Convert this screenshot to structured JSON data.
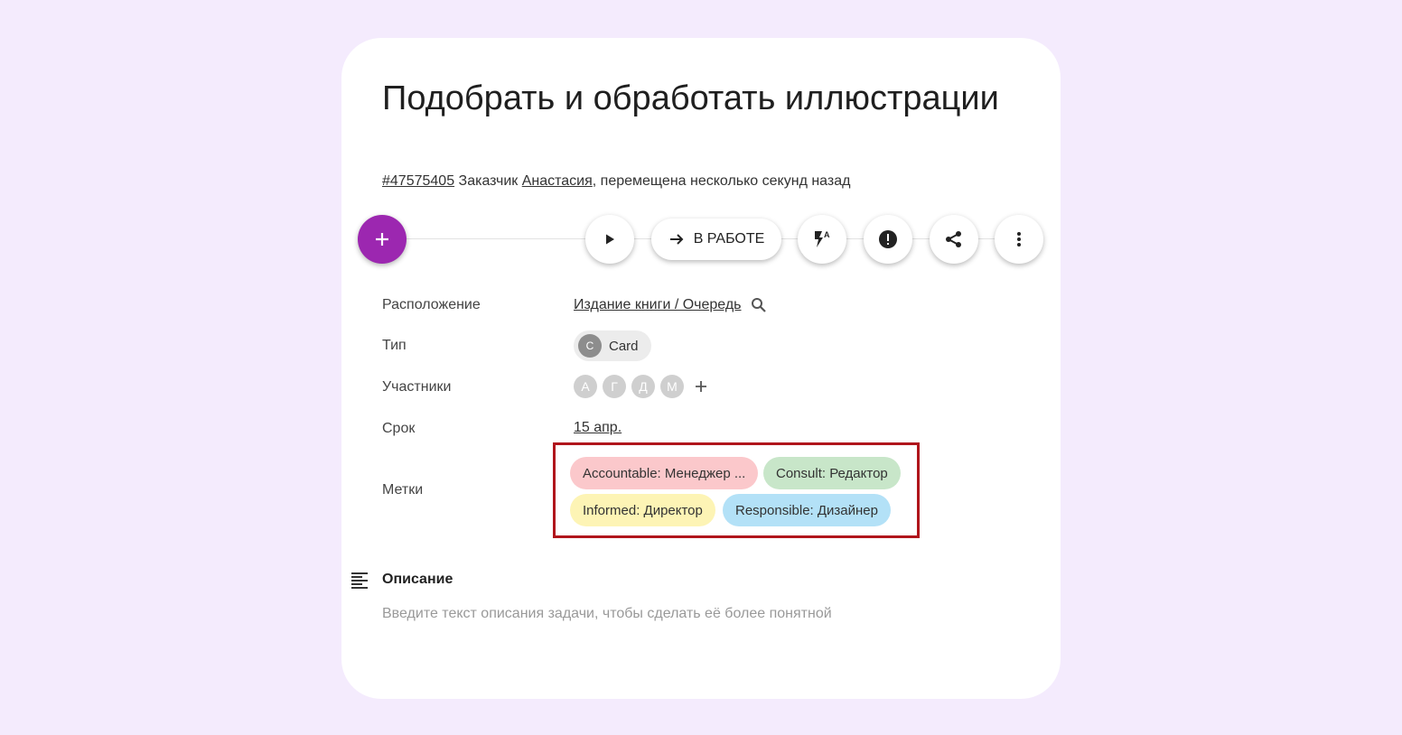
{
  "task": {
    "title": "Подобрать и обработать иллюстрации",
    "id": "#47575405",
    "customer_prefix": "Заказчик",
    "customer": "Анастасия",
    "moved": ", перемещена несколько секунд назад"
  },
  "toolbar": {
    "status_label": "В РАБОТЕ",
    "flash_superscript": "A"
  },
  "fields": {
    "location_label": "Расположение",
    "location_value": "Издание книги / Очередь",
    "type_label": "Тип",
    "type_avatar": "C",
    "type_value": "Card",
    "members_label": "Участники",
    "members": [
      "А",
      "Г",
      "Д",
      "М"
    ],
    "due_label": "Срок",
    "due_value": "15 апр.",
    "tags_label": "Метки",
    "tags": [
      {
        "text": "Accountable: Менеджер ...",
        "color": "#fbc8cb"
      },
      {
        "text": "Consult: Редактор",
        "color": "#c8e6c9"
      },
      {
        "text": "Informed: Директор",
        "color": "#fdf4b5"
      },
      {
        "text": "Responsible: Дизайнер",
        "color": "#b3e1f7"
      }
    ]
  },
  "description": {
    "title": "Описание",
    "placeholder": "Введите текст описания задачи, чтобы сделать её более понятной"
  },
  "colors": {
    "fab": "#9c27b0",
    "highlight_border": "#b0151c",
    "background": "#f4ebfd"
  }
}
